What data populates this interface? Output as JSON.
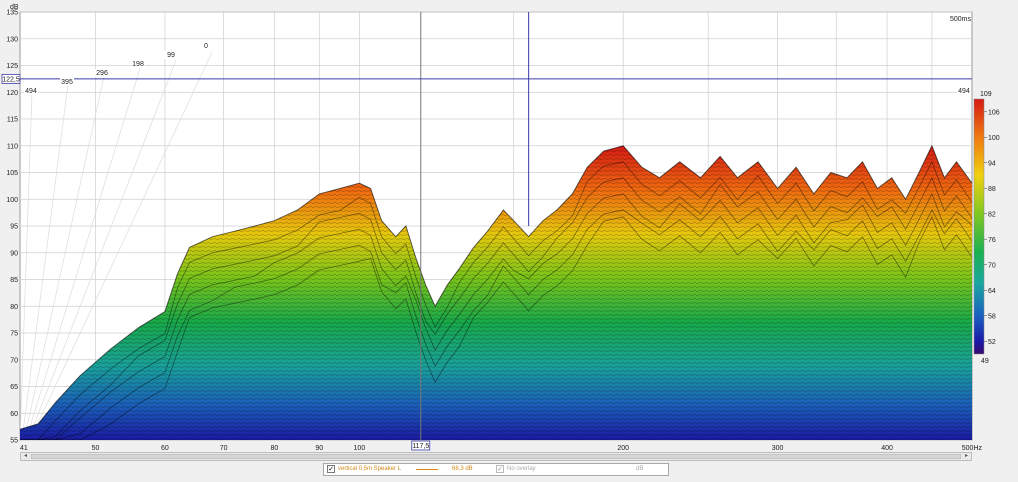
{
  "chart_data": {
    "type": "waterfall",
    "y_unit": "dB",
    "x_unit": "Hz",
    "time_label": "500ms",
    "xlim": [
      41,
      500
    ],
    "ylim": [
      55,
      135
    ],
    "x_scale": "log",
    "x_ticks": [
      {
        "v": 41,
        "label": "41"
      },
      {
        "v": 50,
        "label": "50"
      },
      {
        "v": 60,
        "label": "60"
      },
      {
        "v": 70,
        "label": "70"
      },
      {
        "v": 80,
        "label": "80"
      },
      {
        "v": 90,
        "label": "90"
      },
      {
        "v": 100,
        "label": "100"
      },
      {
        "v": 200,
        "label": "200"
      },
      {
        "v": 300,
        "label": "300"
      },
      {
        "v": 400,
        "label": "400"
      },
      {
        "v": 500,
        "label": "500Hz"
      }
    ],
    "y_ticks": [
      55,
      60,
      65,
      70,
      75,
      80,
      85,
      90,
      95,
      100,
      105,
      110,
      115,
      120,
      125,
      130,
      135
    ],
    "depth_labels": [
      "494",
      "395",
      "296",
      "198",
      "99",
      "0",
      "494"
    ],
    "cursor_x": {
      "value": 117.5,
      "label": "117,5"
    },
    "cursor_y": {
      "value": 122.5,
      "label": "122,5"
    },
    "colorbar": {
      "min": 49,
      "max": 109,
      "ticks": [
        52,
        58,
        64,
        70,
        76,
        82,
        88,
        94,
        100,
        106
      ],
      "min_label": "49",
      "max_label": "109"
    },
    "front_response": [
      {
        "f": 41,
        "db": 57
      },
      {
        "f": 43,
        "db": 58
      },
      {
        "f": 45,
        "db": 62
      },
      {
        "f": 48,
        "db": 67
      },
      {
        "f": 52,
        "db": 72
      },
      {
        "f": 56,
        "db": 76
      },
      {
        "f": 60,
        "db": 79
      },
      {
        "f": 62,
        "db": 86
      },
      {
        "f": 64,
        "db": 91
      },
      {
        "f": 68,
        "db": 93
      },
      {
        "f": 72,
        "db": 94
      },
      {
        "f": 76,
        "db": 95
      },
      {
        "f": 80,
        "db": 96
      },
      {
        "f": 85,
        "db": 98
      },
      {
        "f": 90,
        "db": 101
      },
      {
        "f": 95,
        "db": 102
      },
      {
        "f": 100,
        "db": 103
      },
      {
        "f": 103,
        "db": 102
      },
      {
        "f": 106,
        "db": 96
      },
      {
        "f": 110,
        "db": 93
      },
      {
        "f": 113,
        "db": 95
      },
      {
        "f": 116,
        "db": 89
      },
      {
        "f": 119,
        "db": 84
      },
      {
        "f": 122,
        "db": 80
      },
      {
        "f": 126,
        "db": 84
      },
      {
        "f": 130,
        "db": 87
      },
      {
        "f": 135,
        "db": 91
      },
      {
        "f": 140,
        "db": 94
      },
      {
        "f": 146,
        "db": 98
      },
      {
        "f": 150,
        "db": 96
      },
      {
        "f": 156,
        "db": 93
      },
      {
        "f": 162,
        "db": 96
      },
      {
        "f": 168,
        "db": 98
      },
      {
        "f": 175,
        "db": 101
      },
      {
        "f": 182,
        "db": 106
      },
      {
        "f": 190,
        "db": 109
      },
      {
        "f": 200,
        "db": 110
      },
      {
        "f": 210,
        "db": 106
      },
      {
        "f": 220,
        "db": 104
      },
      {
        "f": 232,
        "db": 107
      },
      {
        "f": 245,
        "db": 104
      },
      {
        "f": 258,
        "db": 108
      },
      {
        "f": 270,
        "db": 104
      },
      {
        "f": 285,
        "db": 107
      },
      {
        "f": 300,
        "db": 102
      },
      {
        "f": 315,
        "db": 106
      },
      {
        "f": 330,
        "db": 101
      },
      {
        "f": 345,
        "db": 105
      },
      {
        "f": 360,
        "db": 104
      },
      {
        "f": 375,
        "db": 107
      },
      {
        "f": 390,
        "db": 102
      },
      {
        "f": 405,
        "db": 104
      },
      {
        "f": 420,
        "db": 100
      },
      {
        "f": 435,
        "db": 105
      },
      {
        "f": 450,
        "db": 110
      },
      {
        "f": 465,
        "db": 104
      },
      {
        "f": 480,
        "db": 107
      },
      {
        "f": 500,
        "db": 103
      }
    ]
  },
  "legend": {
    "trace_name": "vertical 0,5m Speaker L",
    "trace_value": "68,3 dB",
    "trace_color": "#e08a10",
    "overlay_name": "No overlay",
    "overlay_unit": "dB"
  },
  "colors": {
    "grid": "#cfcfcf",
    "plot_bg": "#ffffff",
    "cursor_v": "#3a3aa8",
    "cursor_v_dark": "#777777",
    "cursor_h": "#3a3aa8"
  }
}
